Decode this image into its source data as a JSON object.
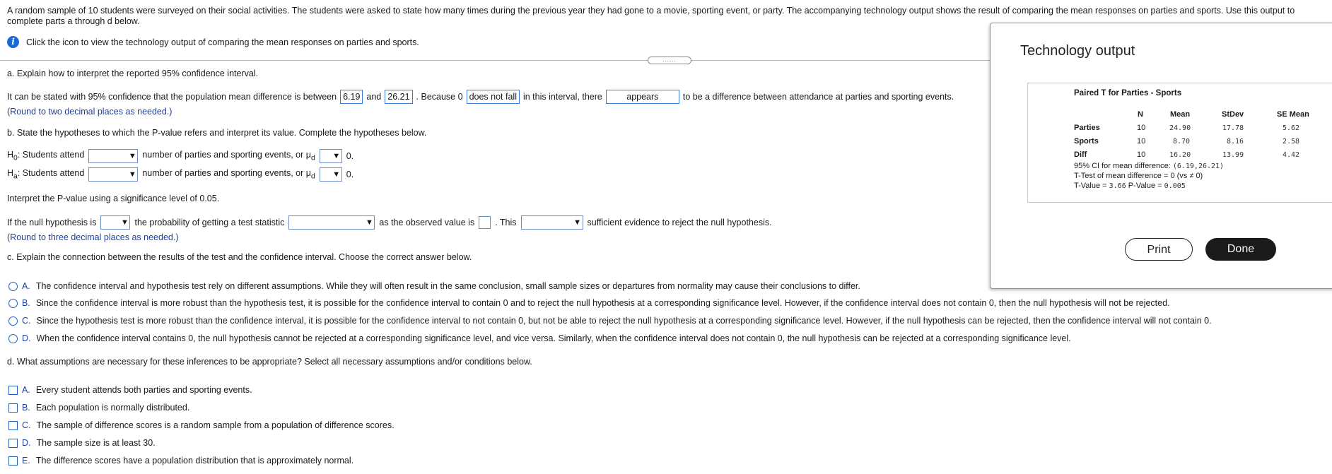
{
  "intro": "A random sample of 10 students were surveyed on their social activities. The students were asked to state how many times during the previous year they had gone to a movie, sporting event, or party. The accompanying technology output shows the result of comparing the mean responses on parties and sports. Use this output to complete parts a through d below.",
  "info_icon": "i",
  "info_text": "Click the icon to view the technology output of comparing the mean responses on parties and sports.",
  "handle_text": "......",
  "part_a": {
    "heading": "a. Explain how to interpret the reported 95% confidence interval.",
    "s1": "It can be stated with 95% confidence that the population mean difference is between",
    "v1": "6.19",
    "s2": "and",
    "v2": "26.21",
    "s3": ". Because 0",
    "v3": "does not fall",
    "s4": "in this interval, there",
    "v4": "appears",
    "s5": "to be a difference between attendance at parties and sporting events.",
    "note": "(Round to two decimal places as needed.)"
  },
  "part_b": {
    "heading": "b. State the hypotheses to which the P-value refers and interpret its value. Complete the hypotheses below.",
    "h0_label": "H",
    "h0_sub": "0",
    "ha_label": "H",
    "ha_sub": "a",
    "attend": ": Students attend",
    "mid": "number of parties and sporting events, or μ",
    "mu_sub": "d",
    "zero": "0.",
    "interpret": "Interpret the P-value using a significance level of 0.05.",
    "p1": "If the null hypothesis is",
    "p2": "the probability of getting a test statistic",
    "p3": "as the observed value is",
    "p4": ". This",
    "p5": "sufficient evidence to reject the null hypothesis.",
    "note": "(Round to three decimal places as needed.)"
  },
  "part_c": {
    "heading": "c. Explain the connection between the results of the test and the confidence interval. Choose the correct answer below.",
    "options": [
      {
        "letter": "A.",
        "text": "The confidence interval and hypothesis test rely on different assumptions. While they will often result in the same conclusion, small sample sizes or departures from normality may cause their conclusions to differ."
      },
      {
        "letter": "B.",
        "text": "Since the confidence interval is more robust than the hypothesis test, it is possible for the confidence interval to contain 0 and to reject the null hypothesis at a corresponding significance level. However, if the confidence interval does not contain 0, then the null hypothesis will not be rejected."
      },
      {
        "letter": "C.",
        "text": "Since the hypothesis test is more robust than the confidence interval, it is possible for the confidence interval to not contain 0, but not be able to reject the null hypothesis at a corresponding significance level. However, if the null hypothesis can be rejected, then the confidence interval will not contain 0."
      },
      {
        "letter": "D.",
        "text": "When the confidence interval contains 0, the null hypothesis cannot be rejected at a corresponding significance level, and vice versa. Similarly, when the confidence interval does not contain 0, the null hypothesis can be rejected at a corresponding significance level."
      }
    ]
  },
  "part_d": {
    "heading": "d. What assumptions are necessary for these inferences to be appropriate? Select all necessary assumptions and/or conditions below.",
    "options": [
      {
        "letter": "A.",
        "text": "Every student attends both parties and sporting events."
      },
      {
        "letter": "B.",
        "text": "Each population is normally distributed."
      },
      {
        "letter": "C.",
        "text": "The sample of difference scores is a random sample from a population of difference scores."
      },
      {
        "letter": "D.",
        "text": "The sample size is at least 30."
      },
      {
        "letter": "E.",
        "text": "The difference scores have a population distribution that is approximately normal."
      }
    ]
  },
  "panel": {
    "title": "Technology output",
    "output_title": "Paired T for Parties - Sports",
    "headers": {
      "n": "N",
      "mean": "Mean",
      "stdev": "StDev",
      "se": "SE Mean"
    },
    "rows": [
      {
        "label": "Parties",
        "n": "10",
        "mean": "24.90",
        "stdev": "17.78",
        "se": "5.62"
      },
      {
        "label": "Sports",
        "n": "10",
        "mean": "8.70",
        "stdev": "8.16",
        "se": "2.58"
      },
      {
        "label": "Diff",
        "n": "10",
        "mean": "16.20",
        "stdev": "13.99",
        "se": "4.42"
      }
    ],
    "ci_label": "95% CI for mean difference:",
    "ci_value": "(6.19,26.21)",
    "ttest": "T-Test of mean difference = 0 (vs ≠ 0)",
    "tvalue_label": "T-Value =",
    "tvalue": "3.66",
    "pvalue_label": "P-Value =",
    "pvalue": "0.005",
    "print_label": "Print",
    "done_label": "Done"
  }
}
